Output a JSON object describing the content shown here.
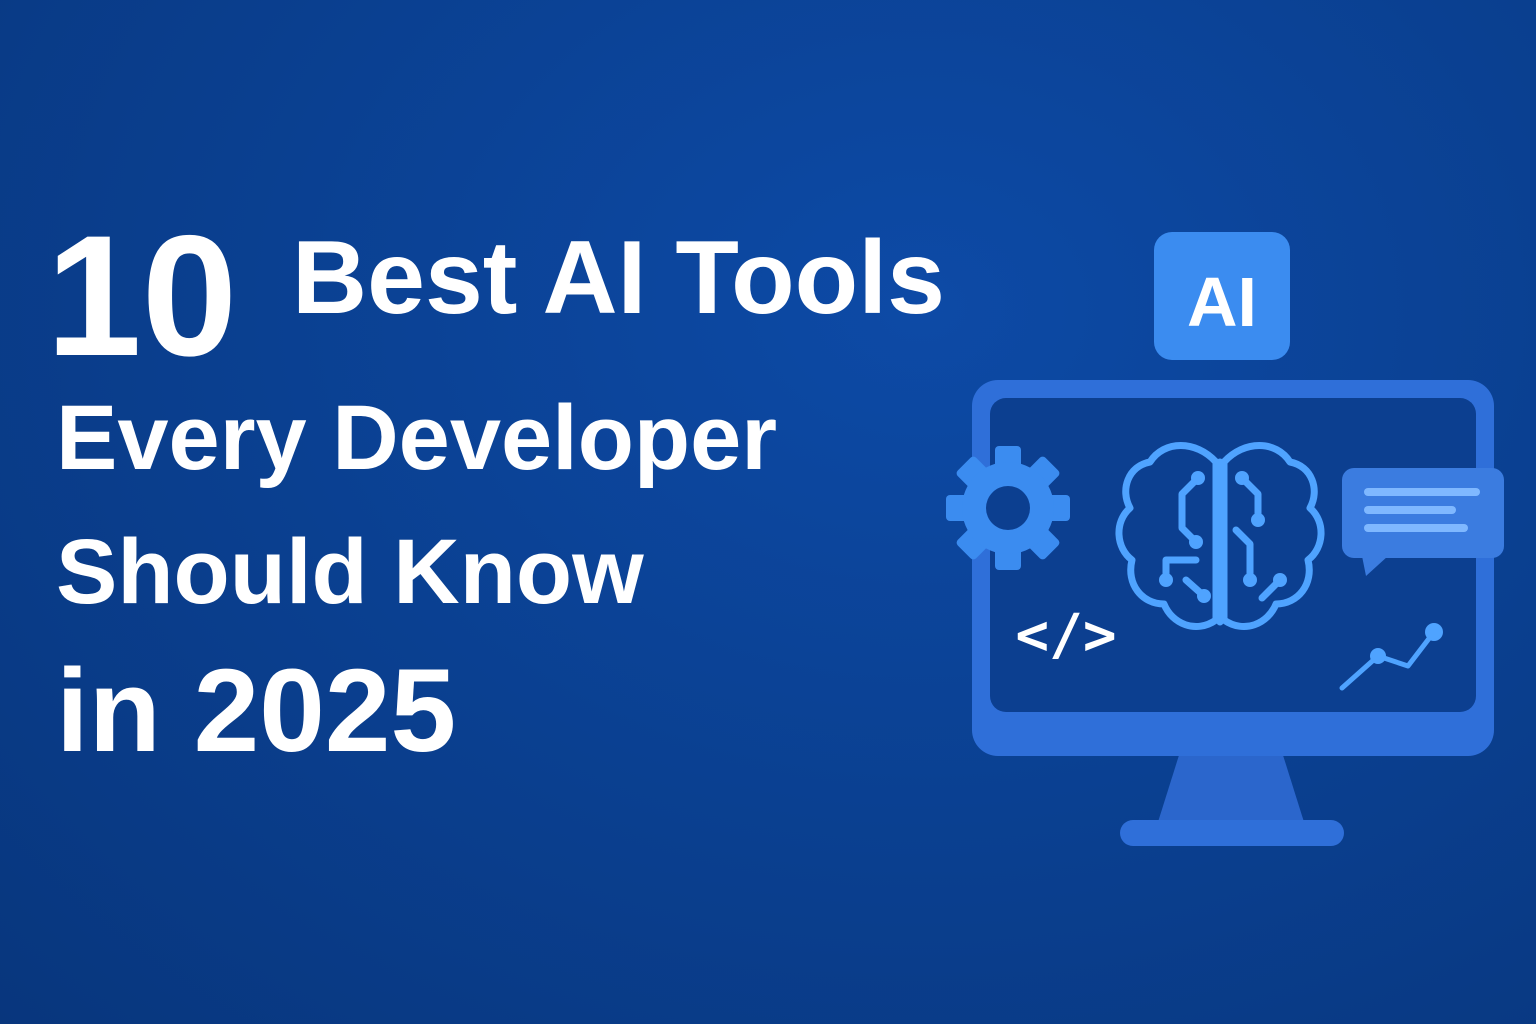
{
  "headline": {
    "number": "10",
    "line1": "Best AI Tools",
    "line2": "Every Developer",
    "line3": "Should Know",
    "line4": "in 2025"
  },
  "illustration": {
    "badge_text": "AI",
    "code_tag": "</>",
    "icons": [
      "ai-badge-icon",
      "monitor-icon",
      "gear-icon",
      "brain-circuit-icon",
      "chat-bubble-icon",
      "code-tag-icon",
      "trend-chart-icon"
    ]
  },
  "colors": {
    "background": "#0a3f8f",
    "accent": "#3b8cf0",
    "accent_light": "#4fa3ff",
    "monitor_frame": "#2f6fd9",
    "screen": "#0c3f90",
    "text": "#ffffff"
  }
}
